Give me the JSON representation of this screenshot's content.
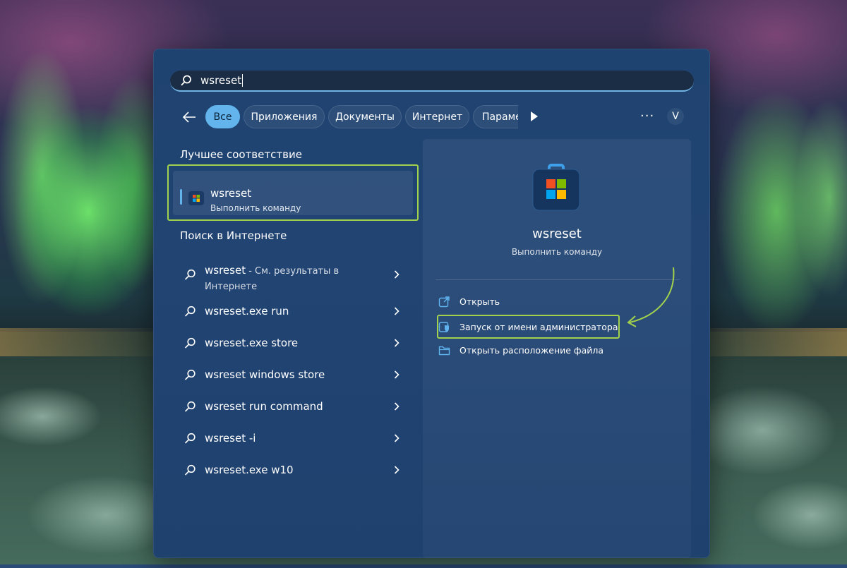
{
  "search": {
    "query": "wsreset"
  },
  "filters": {
    "items": [
      "Все",
      "Приложения",
      "Документы",
      "Интернет"
    ],
    "truncated": "Параметры",
    "avatar_letter": "V",
    "more": "···"
  },
  "best_match": {
    "title": "Лучшее соответствие",
    "name": "wsreset",
    "subtitle": "Выполнить команду"
  },
  "web": {
    "title": "Поиск в Интернете",
    "items": [
      {
        "main": "wsreset",
        "hint": " - См. результаты в",
        "hint2": "Интернете"
      },
      {
        "label": "wsreset.exe run"
      },
      {
        "label": "wsreset.exe store"
      },
      {
        "label": "wsreset windows store"
      },
      {
        "label": "wsreset run command"
      },
      {
        "label": "wsreset -i"
      },
      {
        "label": "wsreset.exe w10"
      }
    ]
  },
  "details": {
    "name": "wsreset",
    "subtitle": "Выполнить команду",
    "actions": [
      {
        "label": "Открыть",
        "icon": "open-external-icon"
      },
      {
        "label": "Запуск от имени администратора",
        "icon": "shield-admin-icon"
      },
      {
        "label": "Открыть расположение файла",
        "icon": "folder-icon"
      }
    ]
  },
  "colors": {
    "accent": "#63b3ec",
    "highlight": "#a2d14d",
    "panel": "#214473"
  }
}
